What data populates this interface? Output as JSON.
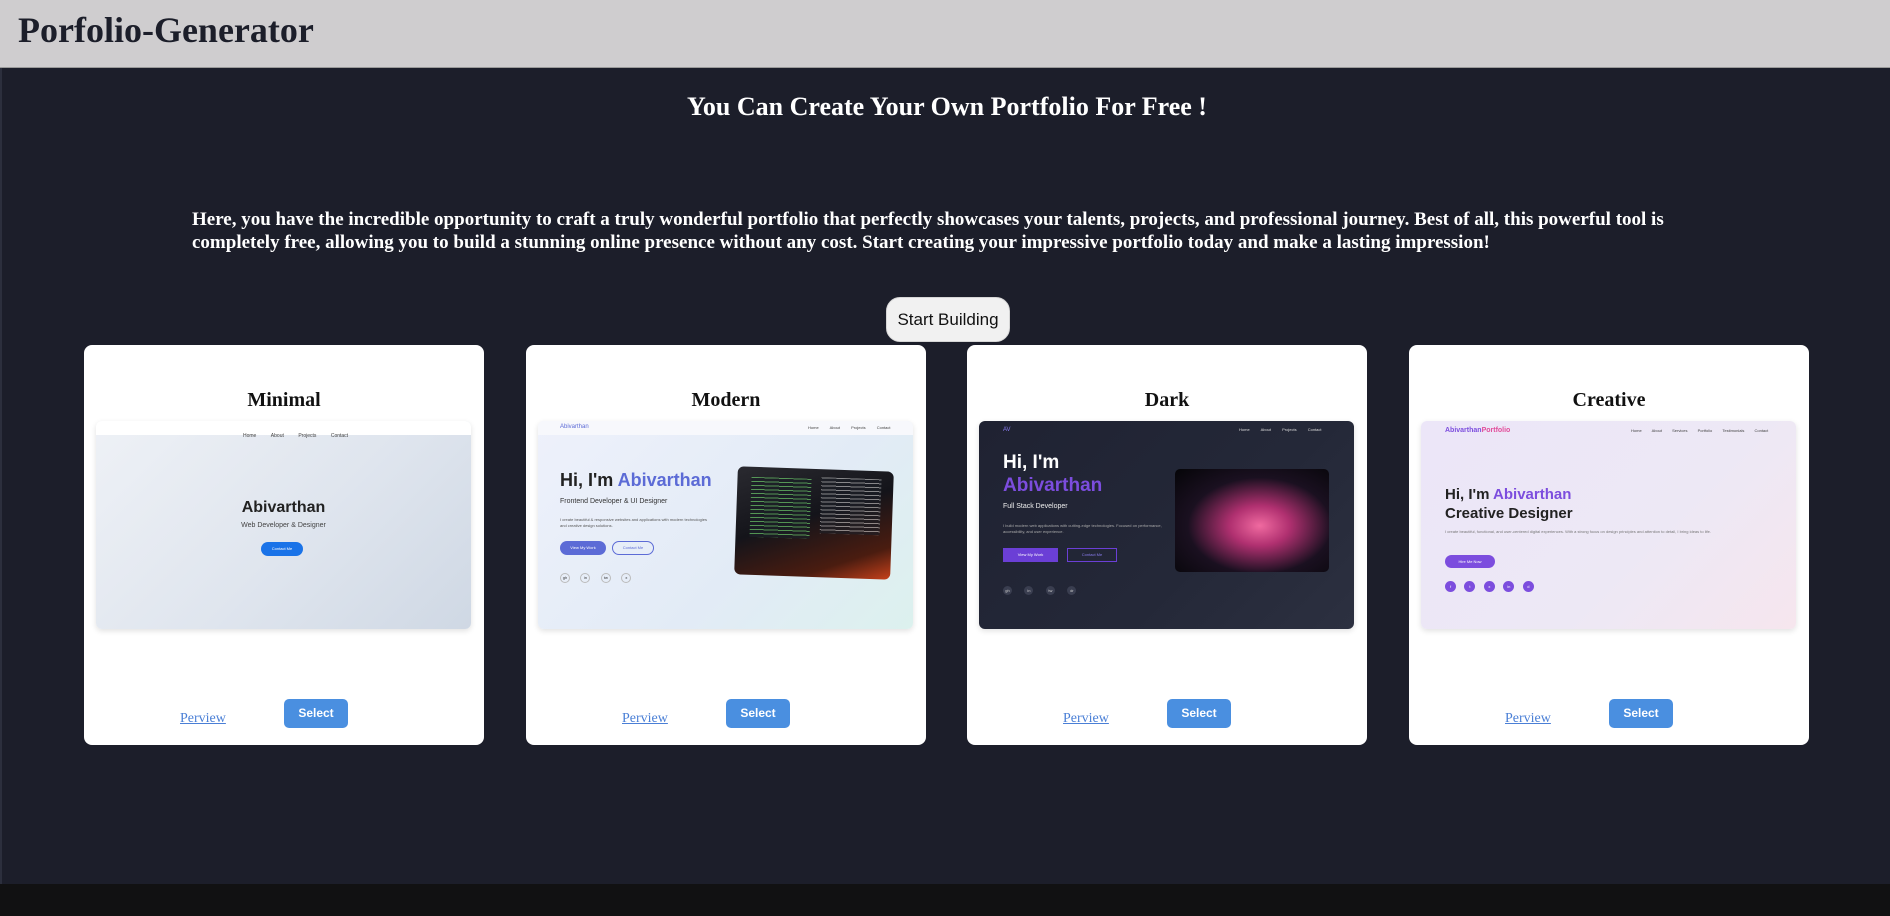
{
  "header": {
    "brand": "Porfolio-Generator"
  },
  "hero": {
    "title": "You Can Create Your Own Portfolio For Free !",
    "description": "Here, you have the incredible opportunity to craft a truly wonderful portfolio that perfectly showcases your talents, projects, and professional journey. Best of all, this powerful tool is completely free, allowing you to build a stunning online presence without any cost. Start creating your impressive portfolio today and make a lasting impression!",
    "cta_label": "Start Building"
  },
  "templates": [
    {
      "title": "Minimal",
      "preview_label": "Perview",
      "select_label": "Select",
      "preview": {
        "nav": [
          "Home",
          "About",
          "Projects",
          "Contact"
        ],
        "name": "Abivarthan",
        "role": "Web Developer & Designer",
        "button": "Contact Me"
      }
    },
    {
      "title": "Modern",
      "preview_label": "Perview",
      "select_label": "Select",
      "preview": {
        "logo": "Abivarthan",
        "nav": [
          "Home",
          "About",
          "Projects",
          "Contact"
        ],
        "greeting": "Hi, I'm",
        "name": "Abivarthan",
        "role": "Frontend Developer & UI Designer",
        "description": "I create beautiful & responsive websites and applications with modern technologies and creative design solutions.",
        "button_primary": "View My Work",
        "button_secondary": "Contact Me",
        "socials": [
          "gh",
          "in",
          "tw",
          "x"
        ]
      }
    },
    {
      "title": "Dark",
      "preview_label": "Perview",
      "select_label": "Select",
      "preview": {
        "logo": "AV",
        "nav": [
          "Home",
          "About",
          "Projects",
          "Contact"
        ],
        "greeting": "Hi, I'm",
        "name": "Abivarthan",
        "role": "Full Stack Developer",
        "description": "I build modern web applications with cutting-edge technologies. Focused on performance, accessibility, and user experience.",
        "button_primary": "View My Work",
        "button_secondary": "Contact Me",
        "socials": [
          "gh",
          "in",
          "tw",
          "dr"
        ]
      }
    },
    {
      "title": "Creative",
      "preview_label": "Perview",
      "select_label": "Select",
      "preview": {
        "logo_main": "Abivarthan",
        "logo_accent": "Portfolio",
        "nav": [
          "Home",
          "About",
          "Services",
          "Portfolio",
          "Testimonials",
          "Contact"
        ],
        "greeting": "Hi, I'm",
        "name": "Abivarthan",
        "role": "Creative Designer",
        "description": "I create beautiful, functional, and user-centered digital experiences. With a strong focus on design principles and attention to detail, I bring ideas to life.",
        "button_primary": "Hire Me Now",
        "socials": [
          "f",
          "t",
          "x",
          "in",
          "d"
        ]
      }
    }
  ],
  "colors": {
    "page_bg": "#1c1e2a",
    "topbar_bg": "#cfcdcf",
    "select_button": "#4a8fe0",
    "link": "#4a7fd6"
  }
}
